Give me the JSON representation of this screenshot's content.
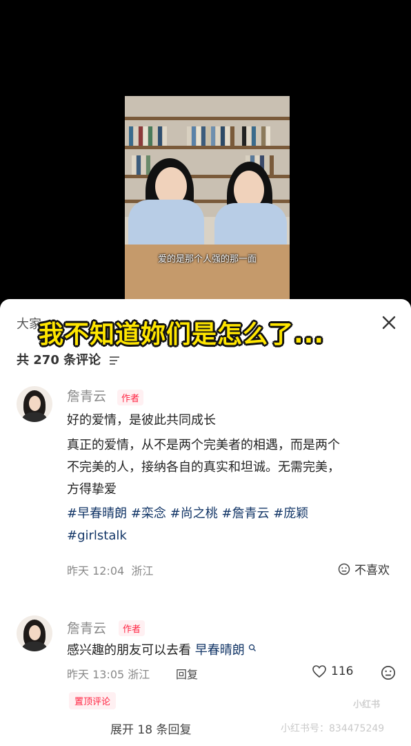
{
  "video": {
    "subtitle": "爱的是那个人强的那一面"
  },
  "overlay": {
    "title": "我不知道妳们是怎么了..."
  },
  "sheet": {
    "header_partial": "大家",
    "comment_count": "共 270 条评论"
  },
  "comments": [
    {
      "author": "詹青云",
      "badge": "作者",
      "lines": [
        "好的爱情，是彼此共同成长",
        "真正的爱情，从不是两个完美者的相遇，而是两个",
        "不完美的人，接纳各自的真实和坦诚。无需完美，",
        "方得挚爱"
      ],
      "hashtags_line1": "#早春晴朗 #栾念 #尚之桃 #詹青云 #庞颖",
      "hashtags_line2": "#girlstalk",
      "time": "昨天 12:04",
      "location": "浙江",
      "dislike_label": "不喜欢"
    },
    {
      "author": "詹青云",
      "badge": "作者",
      "text": "感兴趣的朋友可以去看",
      "link": "早春晴朗",
      "time": "昨天 13:05",
      "location": "浙江",
      "reply_label": "回复",
      "likes": "116",
      "pinned_label": "置顶评论",
      "expand_label": "展开 18 条回复"
    }
  ],
  "watermark": {
    "logo": "小红书",
    "id_text": "小红书号：834475249"
  },
  "colors": {
    "accent": "#ff2442",
    "hashtag": "#133667",
    "overlay_text": "#ffe600"
  }
}
